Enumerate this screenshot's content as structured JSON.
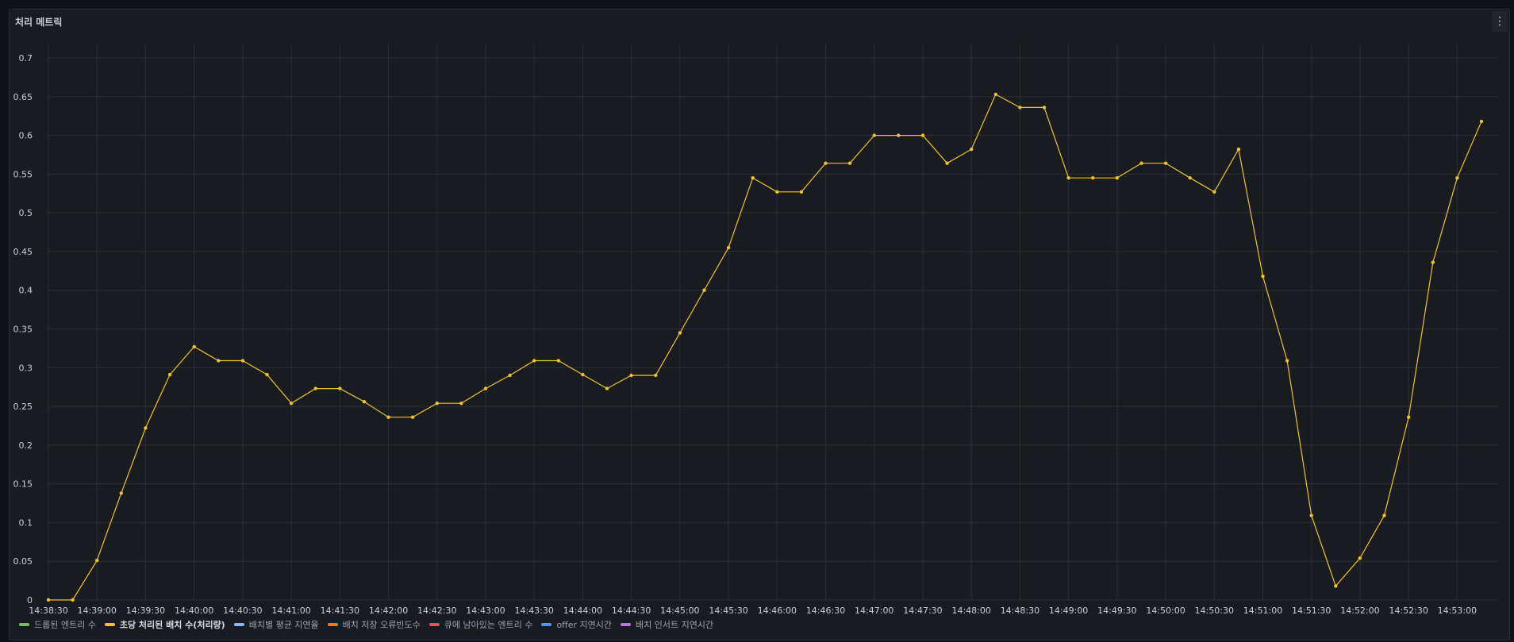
{
  "panel": {
    "title": "처리 메트릭",
    "menu_icon": "⋮"
  },
  "colors": {
    "line": "#f2c12e",
    "grid": "#2c2f35",
    "background": "#181b1f"
  },
  "legend": [
    {
      "label": "드롭된 엔트리 수",
      "color": "#73bf69",
      "active": false
    },
    {
      "label": "초당 처리된 배치 수(처리량)",
      "color": "#f2c12e",
      "active": true
    },
    {
      "label": "배치별 평균 지연율",
      "color": "#8ab8ff",
      "active": false
    },
    {
      "label": "배치 저장 오류빈도수",
      "color": "#ff780a",
      "active": false
    },
    {
      "label": "큐에 남아있는 엔트리 수",
      "color": "#f2495c",
      "active": false
    },
    {
      "label": "offer 지연시간",
      "color": "#5794f2",
      "active": false
    },
    {
      "label": "배치 인서트 지연시간",
      "color": "#b877d9",
      "active": false
    }
  ],
  "chart_data": {
    "type": "line",
    "grid": true,
    "ylim": [
      0,
      0.7
    ],
    "yticks": [
      "0",
      "0.05",
      "0.1",
      "0.15",
      "0.2",
      "0.25",
      "0.3",
      "0.35",
      "0.4",
      "0.45",
      "0.5",
      "0.55",
      "0.6",
      "0.65",
      "0.7"
    ],
    "xticks": [
      "14:38:30",
      "14:39:00",
      "14:39:30",
      "14:40:00",
      "14:40:30",
      "14:41:00",
      "14:41:30",
      "14:42:00",
      "14:42:30",
      "14:43:00",
      "14:43:30",
      "14:44:00",
      "14:44:30",
      "14:45:00",
      "14:45:30",
      "14:46:00",
      "14:46:30",
      "14:47:00",
      "14:47:30",
      "14:48:00",
      "14:48:30",
      "14:49:00",
      "14:49:30",
      "14:50:00",
      "14:50:30",
      "14:51:00",
      "14:51:30",
      "14:52:00",
      "14:52:30",
      "14:53:00"
    ],
    "x_start": "14:38:30",
    "x_interval_seconds": 15,
    "series": [
      {
        "name": "초당 처리된 배치 수(처리량)",
        "color": "#f2c12e",
        "values": [
          0,
          0,
          0.051,
          0.138,
          0.222,
          0.291,
          0.327,
          0.309,
          0.309,
          0.291,
          0.254,
          0.273,
          0.273,
          0.256,
          0.236,
          0.236,
          0.254,
          0.254,
          0.273,
          0.29,
          0.309,
          0.309,
          0.291,
          0.273,
          0.29,
          0.29,
          0.345,
          0.4,
          0.455,
          0.545,
          0.527,
          0.527,
          0.564,
          0.564,
          0.6,
          0.6,
          0.6,
          0.564,
          0.582,
          0.653,
          0.636,
          0.636,
          0.545,
          0.545,
          0.545,
          0.564,
          0.564,
          0.545,
          0.527,
          0.582,
          0.418,
          0.309,
          0.109,
          0.018,
          0.054,
          0.109,
          0.236,
          0.436,
          0.545,
          0.618
        ]
      }
    ]
  }
}
